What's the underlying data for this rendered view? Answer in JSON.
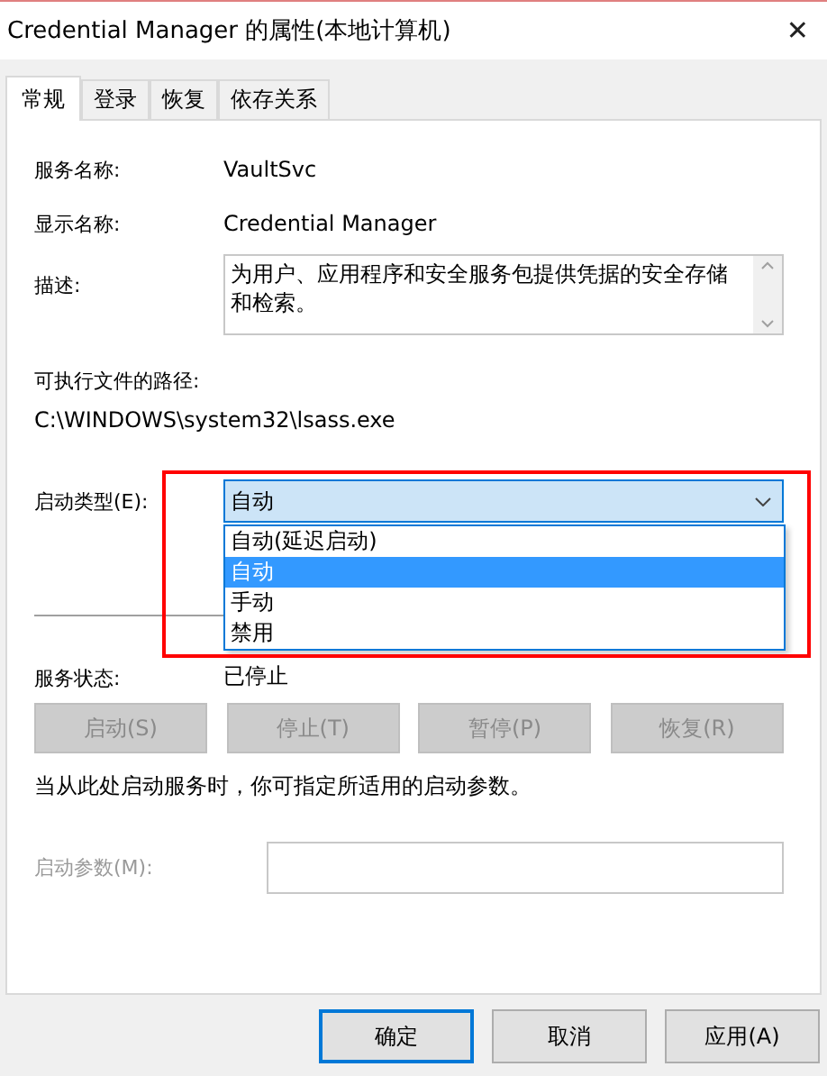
{
  "window": {
    "title": "Credential Manager 的属性(本地计算机)",
    "close": "✕"
  },
  "tabs": [
    {
      "label": "常规",
      "selected": true
    },
    {
      "label": "登录",
      "selected": false
    },
    {
      "label": "恢复",
      "selected": false
    },
    {
      "label": "依存关系",
      "selected": false
    }
  ],
  "general": {
    "service_name": {
      "label": "服务名称:",
      "value": "VaultSvc"
    },
    "display_name": {
      "label": "显示名称:",
      "value": "Credential Manager"
    },
    "description": {
      "label": "描述:",
      "value": "为用户、应用程序和安全服务包提供凭据的安全存储和检索。"
    },
    "path": {
      "label": "可执行文件的路径:",
      "value": "C:\\WINDOWS\\system32\\lsass.exe"
    },
    "startup_type": {
      "label": "启动类型(E):",
      "value": "自动",
      "expanded": true,
      "options": [
        {
          "label": "自动(延迟启动)",
          "selected": false
        },
        {
          "label": "自动",
          "selected": true
        },
        {
          "label": "手动",
          "selected": false
        },
        {
          "label": "禁用",
          "selected": false
        }
      ]
    },
    "service_status": {
      "label": "服务状态:",
      "value": "已停止"
    },
    "service_buttons": [
      {
        "label": "启动(S)",
        "disabled": true
      },
      {
        "label": "停止(T)",
        "disabled": true
      },
      {
        "label": "暂停(P)",
        "disabled": true
      },
      {
        "label": "恢复(R)",
        "disabled": true
      }
    ],
    "hint": "当从此处启动服务时，你可指定所适用的启动参数。",
    "start_params": {
      "label": "启动参数(M):",
      "disabled": true
    }
  },
  "buttons": [
    {
      "label": "确定",
      "default": true
    },
    {
      "label": "取消",
      "default": false
    },
    {
      "label": "应用(A)",
      "default": false
    }
  ]
}
